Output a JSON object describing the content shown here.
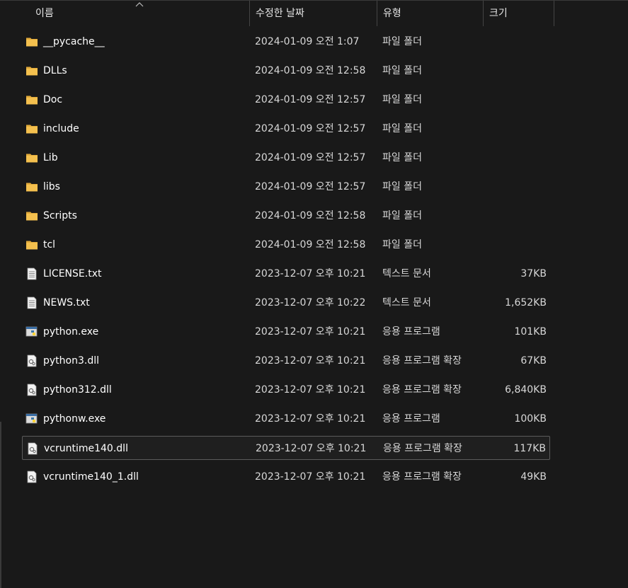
{
  "header": {
    "name_label": "이름",
    "date_label": "수정한 날짜",
    "type_label": "유형",
    "size_label": "크기"
  },
  "colors": {
    "background": "#191919",
    "folder": "#f4c04e",
    "text": "#ffffff",
    "python_blue": "#3c78aa",
    "python_yellow": "#ffd43b"
  },
  "files": [
    {
      "name": "__pycache__",
      "date": "2024-01-09 오전 1:07",
      "type": "파일 폴더",
      "size": "",
      "icon": "folder-icon",
      "selected": false
    },
    {
      "name": "DLLs",
      "date": "2024-01-09 오전 12:58",
      "type": "파일 폴더",
      "size": "",
      "icon": "folder-icon",
      "selected": false
    },
    {
      "name": "Doc",
      "date": "2024-01-09 오전 12:57",
      "type": "파일 폴더",
      "size": "",
      "icon": "folder-icon",
      "selected": false
    },
    {
      "name": "include",
      "date": "2024-01-09 오전 12:57",
      "type": "파일 폴더",
      "size": "",
      "icon": "folder-icon",
      "selected": false
    },
    {
      "name": "Lib",
      "date": "2024-01-09 오전 12:57",
      "type": "파일 폴더",
      "size": "",
      "icon": "folder-icon",
      "selected": false
    },
    {
      "name": "libs",
      "date": "2024-01-09 오전 12:57",
      "type": "파일 폴더",
      "size": "",
      "icon": "folder-icon",
      "selected": false
    },
    {
      "name": "Scripts",
      "date": "2024-01-09 오전 12:58",
      "type": "파일 폴더",
      "size": "",
      "icon": "folder-icon",
      "selected": false
    },
    {
      "name": "tcl",
      "date": "2024-01-09 오전 12:58",
      "type": "파일 폴더",
      "size": "",
      "icon": "folder-icon",
      "selected": false
    },
    {
      "name": "LICENSE.txt",
      "date": "2023-12-07 오후 10:21",
      "type": "텍스트 문서",
      "size": "37KB",
      "icon": "text-file-icon",
      "selected": false
    },
    {
      "name": "NEWS.txt",
      "date": "2023-12-07 오후 10:22",
      "type": "텍스트 문서",
      "size": "1,652KB",
      "icon": "text-file-icon",
      "selected": false
    },
    {
      "name": "python.exe",
      "date": "2023-12-07 오후 10:21",
      "type": "응용 프로그램",
      "size": "101KB",
      "icon": "python-exe-icon",
      "selected": false
    },
    {
      "name": "python3.dll",
      "date": "2023-12-07 오후 10:21",
      "type": "응용 프로그램 확장",
      "size": "67KB",
      "icon": "dll-file-icon",
      "selected": false
    },
    {
      "name": "python312.dll",
      "date": "2023-12-07 오후 10:21",
      "type": "응용 프로그램 확장",
      "size": "6,840KB",
      "icon": "dll-file-icon",
      "selected": false
    },
    {
      "name": "pythonw.exe",
      "date": "2023-12-07 오후 10:21",
      "type": "응용 프로그램",
      "size": "100KB",
      "icon": "python-exe-icon",
      "selected": false
    },
    {
      "name": "vcruntime140.dll",
      "date": "2023-12-07 오후 10:21",
      "type": "응용 프로그램 확장",
      "size": "117KB",
      "icon": "dll-file-icon",
      "selected": true
    },
    {
      "name": "vcruntime140_1.dll",
      "date": "2023-12-07 오후 10:21",
      "type": "응용 프로그램 확장",
      "size": "49KB",
      "icon": "dll-file-icon",
      "selected": false
    }
  ]
}
